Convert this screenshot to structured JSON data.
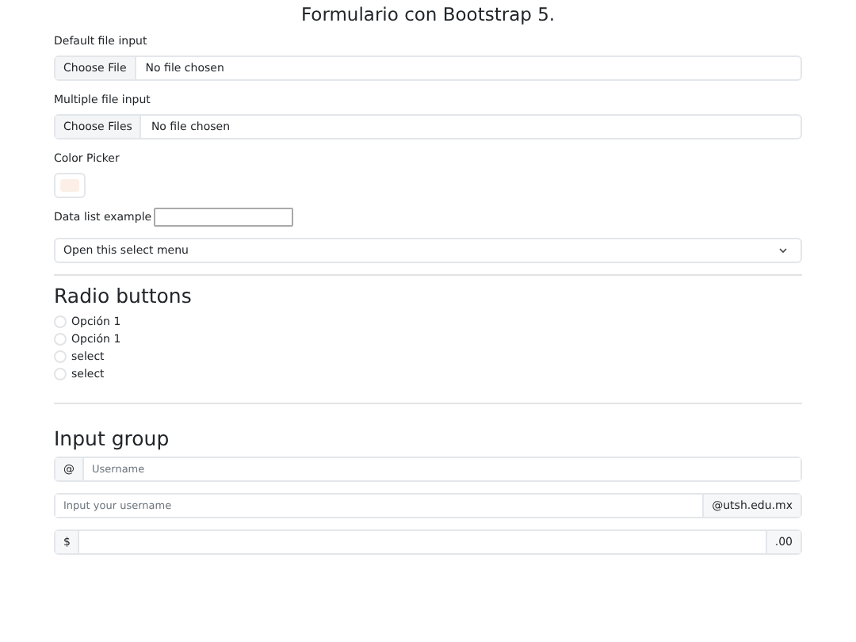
{
  "title": "Formulario con Bootstrap 5.",
  "file_inputs": [
    {
      "label": "Default file input",
      "button": "Choose File",
      "status": "No file chosen"
    },
    {
      "label": "Multiple file input",
      "button": "Choose Files",
      "status": "No file chosen"
    }
  ],
  "color_picker": {
    "label": "Color Picker",
    "color": "#fcefe8"
  },
  "datalist": {
    "label": "Data list example"
  },
  "select": {
    "value": "Open this select menu"
  },
  "radio_section": {
    "heading": "Radio buttons",
    "options": [
      {
        "label": "Opción 1",
        "checked": false
      },
      {
        "label": "Opción 1",
        "checked": false
      },
      {
        "label": "select",
        "checked": false
      },
      {
        "label": "select",
        "checked": false
      }
    ]
  },
  "input_group_section": {
    "heading": "Input group",
    "groups": [
      {
        "prefix": "@",
        "placeholder": "Username"
      },
      {
        "placeholder": "Input your username",
        "suffix": "@utsh.edu.mx"
      },
      {
        "prefix": "$",
        "suffix": ".00"
      }
    ]
  }
}
